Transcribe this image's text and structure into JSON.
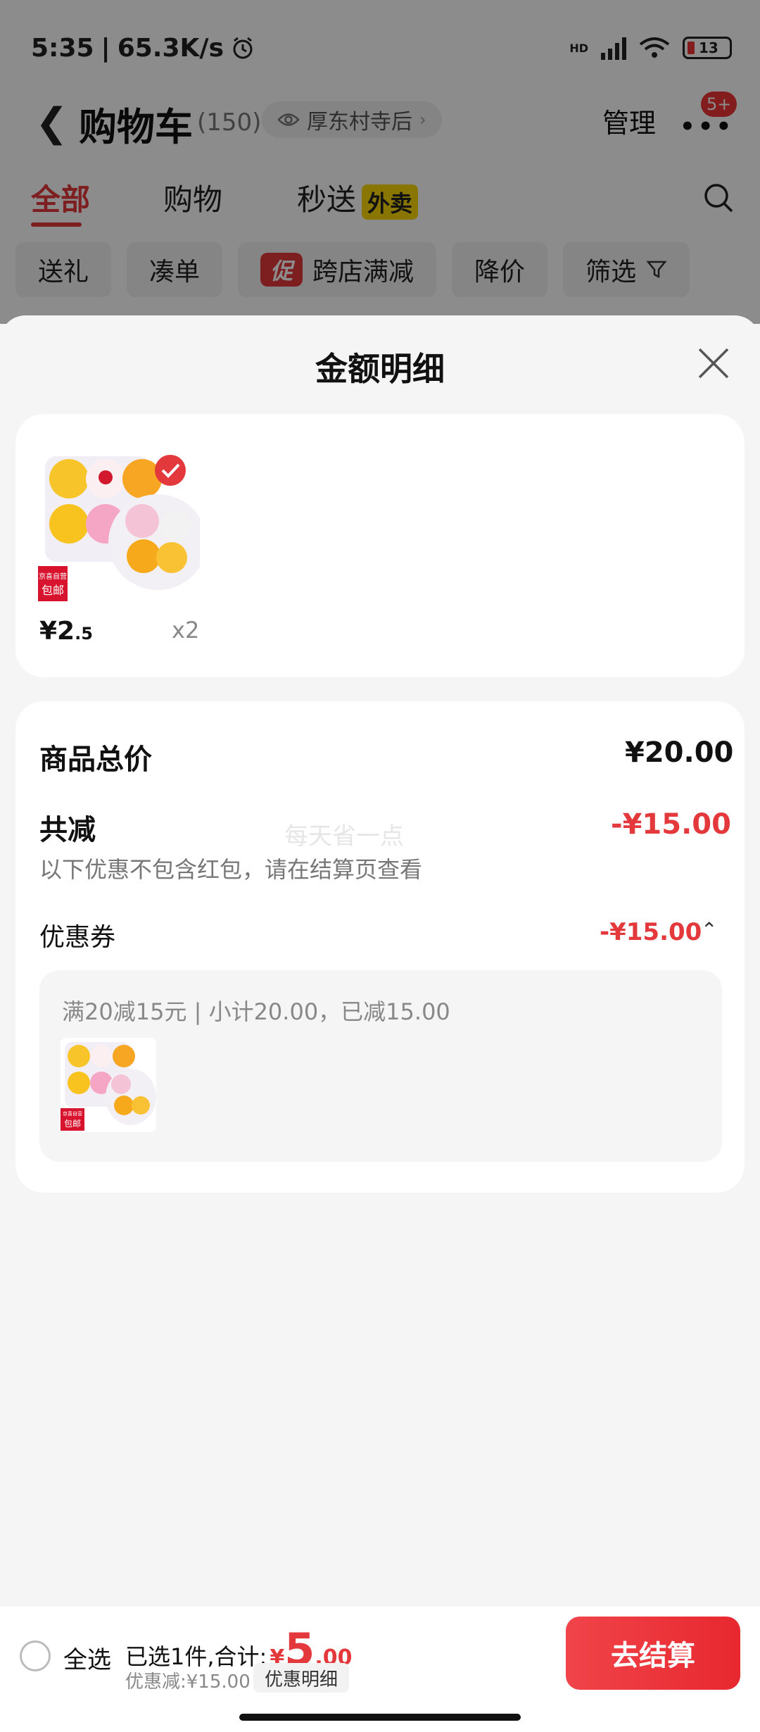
{
  "status": {
    "time": "5:35",
    "speed": "65.3K/s",
    "battery": "13",
    "hd": "HD",
    "wifi_sub": "6"
  },
  "header": {
    "title": "购物车",
    "count": "(150)",
    "location": "厚东村寺后",
    "manage": "管理",
    "badge": "5+"
  },
  "tabs": [
    {
      "label": "全部",
      "active": true
    },
    {
      "label": "购物"
    },
    {
      "label": "秒送",
      "tag": "外卖"
    }
  ],
  "filters": [
    {
      "label": "送礼"
    },
    {
      "label": "凑单"
    },
    {
      "label": "跨店满减",
      "icon": "促"
    },
    {
      "label": "降价"
    },
    {
      "label": "筛选"
    }
  ],
  "sheet": {
    "title": "金额明细",
    "product": {
      "badge_line1": "京喜自营",
      "badge_line2": "包邮",
      "price_main": "¥2",
      "price_dec": ".5",
      "qty": "x2"
    },
    "summary": {
      "total_label": "商品总价",
      "total_value": "¥20.00",
      "reduce_label": "共减",
      "reduce_value": "-¥15.00",
      "note": "以下优惠不包含红包，请在结算页查看",
      "watermark": "每天省一点",
      "coupon_label": "优惠券",
      "coupon_value": "-¥15.00",
      "coupon_detail": "满20减15元 | 小计20.00，已减15.00"
    }
  },
  "bottom": {
    "select_all": "全选",
    "selected_text": "已选1件,合计:",
    "currency": "¥",
    "total_int": "5",
    "total_dec": ".00",
    "discount_text": "优惠减:¥15.00",
    "detail_button": "优惠明细",
    "checkout": "去结算"
  },
  "colors": {
    "accent": "#e4393c",
    "waimai": "#f8d800"
  }
}
